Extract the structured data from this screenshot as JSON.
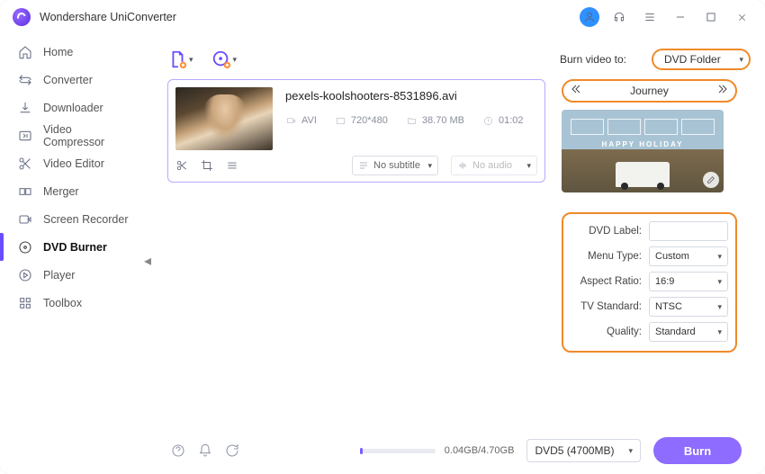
{
  "app": {
    "title": "Wondershare UniConverter"
  },
  "sidebar": {
    "items": [
      {
        "label": "Home"
      },
      {
        "label": "Converter"
      },
      {
        "label": "Downloader"
      },
      {
        "label": "Video Compressor"
      },
      {
        "label": "Video Editor"
      },
      {
        "label": "Merger"
      },
      {
        "label": "Screen Recorder"
      },
      {
        "label": "DVD Burner"
      },
      {
        "label": "Player"
      },
      {
        "label": "Toolbox"
      }
    ]
  },
  "toolbar": {
    "burn_to_label": "Burn video to:",
    "burn_to_value": "DVD Folder"
  },
  "file": {
    "name": "pexels-koolshooters-8531896.avi",
    "format": "AVI",
    "resolution": "720*480",
    "size": "38.70 MB",
    "duration": "01:02",
    "subtitle": "No subtitle",
    "audio": "No audio"
  },
  "template": {
    "name": "Journey",
    "caption": "HAPPY HOLIDAY"
  },
  "settings": {
    "labels": {
      "dvd_label": "DVD Label:",
      "menu_type": "Menu Type:",
      "aspect": "Aspect Ratio:",
      "tv": "TV Standard:",
      "quality": "Quality:"
    },
    "values": {
      "dvd_label": "",
      "menu_type": "Custom",
      "aspect": "16:9",
      "tv": "NTSC",
      "quality": "Standard"
    }
  },
  "footer": {
    "progress_text": "0.04GB/4.70GB",
    "disc_type": "DVD5 (4700MB)",
    "burn_label": "Burn"
  }
}
